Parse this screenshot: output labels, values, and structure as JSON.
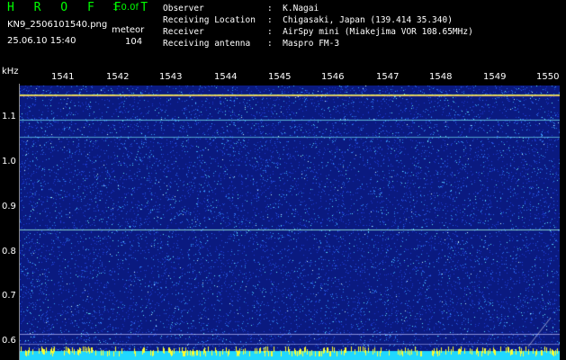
{
  "header": {
    "brand": "H R O F F T",
    "version": "1.0.0f",
    "filename": "KN9_2506101540.png",
    "timestamp": "25.06.10 15:40",
    "meteor_label": "meteor",
    "meteor_count": "104",
    "meta": [
      {
        "label": "Observer",
        "value": "K.Nagai"
      },
      {
        "label": "Receiving Location",
        "value": "Chigasaki, Japan (139.414 35.340)"
      },
      {
        "label": "Receiver",
        "value": "AirSpy mini (Miakejima VOR 108.65MHz)"
      },
      {
        "label": "Receiving antenna",
        "value": "Maspro FM-3"
      }
    ]
  },
  "spectrogram": {
    "unit": "kHz",
    "time_labels": [
      "1541",
      "1542",
      "1543",
      "1544",
      "1545",
      "1546",
      "1547",
      "1548",
      "1549",
      "1550"
    ],
    "freq_labels": [
      "1.1",
      "1.0",
      "0.9",
      "0.8",
      "0.7",
      "0.6"
    ],
    "colors": {
      "bg": "#0a1a8a",
      "noise_hi": "#40e0ff",
      "line": "#9fffff",
      "hot": "#ffff40"
    }
  }
}
